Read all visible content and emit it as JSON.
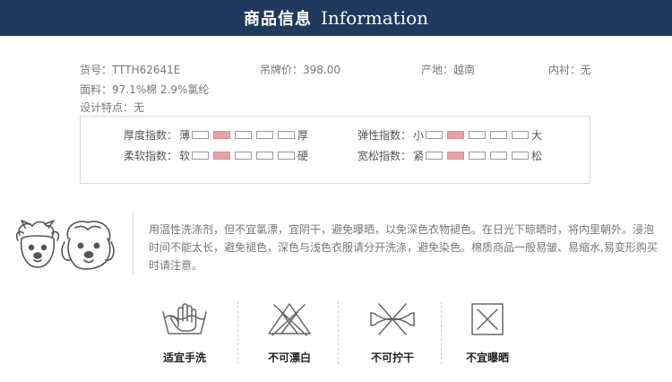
{
  "header": {
    "title_zh": "商品信息",
    "title_en": "Information"
  },
  "product": {
    "sku": "货号：TTTH62641E",
    "price": "吊牌价：398.00",
    "origin": "产地：越南",
    "lining": "内衬：无",
    "material": "面料：97.1%棉 2.9%氯纶",
    "design": "设计特点：无"
  },
  "scales": [
    {
      "label": "厚度指数：",
      "low": "薄",
      "high": "厚",
      "level": 2
    },
    {
      "label": "弹性指数：",
      "low": "小",
      "high": "大",
      "level": 2
    },
    {
      "label": "柔软指数：",
      "low": "软",
      "high": "硬",
      "level": 2
    },
    {
      "label": "宽松指数：",
      "low": "紧",
      "high": "松",
      "level": 2
    }
  ],
  "care": {
    "text": "用温性洗涤剂，但不宜氯漂，宜阴干，避免曝晒，以免深色衣物褪色。在日光下晾晒时，将内里朝外。浸泡时间不能太长，避免褪色，深色与浅色衣服请分开洗涤，避免染色。棉质商品一般易皱、易缩水,易变形购买时请注意。",
    "items": [
      {
        "icon": "hand-wash-icon",
        "label": "适宜手洗"
      },
      {
        "icon": "no-bleach-icon",
        "label": "不可漂白"
      },
      {
        "icon": "no-wring-icon",
        "label": "不可拧干"
      },
      {
        "icon": "no-tumble-dry-icon",
        "label": "不宜曝晒"
      }
    ]
  },
  "colors": {
    "banner": "#1f3a5c",
    "scale_active": "#e5a3a9"
  }
}
